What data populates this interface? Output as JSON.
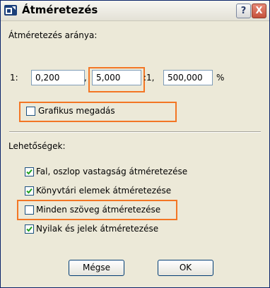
{
  "window": {
    "title": "Átméretezés"
  },
  "resize_ratio": {
    "label": "Átméretezés aránya:",
    "prefix": "1:",
    "value1": "0,200",
    "sep1": ",",
    "value2": "5,000",
    "sep2": ":1,",
    "value3": "500,000",
    "unit": "%"
  },
  "graphic_input": {
    "label": "Grafikus megadás",
    "checked": false
  },
  "options": {
    "heading": "Lehetőségek:",
    "items": [
      {
        "label": "Fal, oszlop vastagság átméretezése",
        "checked": true
      },
      {
        "label": "Könyvtári elemek átméretezése",
        "checked": true
      },
      {
        "label": "Minden szöveg átméretezése",
        "checked": false
      },
      {
        "label": "Nyilak és jelek átméretezése",
        "checked": true
      }
    ]
  },
  "buttons": {
    "cancel": "Mégse",
    "ok": "OK"
  },
  "title_buttons": {
    "help": "?",
    "close": "X"
  },
  "colors": {
    "highlight": "#f37624",
    "check": "#21a121"
  }
}
